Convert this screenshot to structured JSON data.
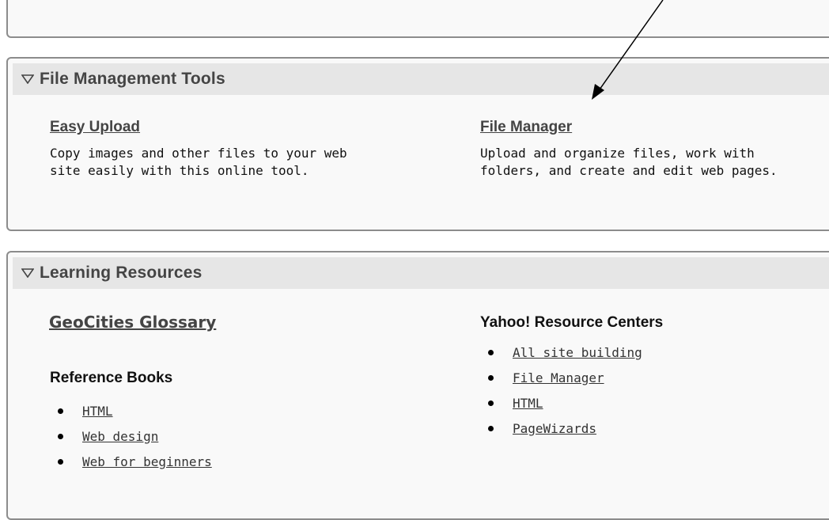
{
  "file_management": {
    "title": "File Management Tools",
    "easy_upload": {
      "label": "Easy Upload",
      "description": "Copy images and other files to your web\nsite easily with this online tool."
    },
    "file_manager": {
      "label": "File Manager",
      "description": "Upload and organize files, work with\nfolders, and create and edit web pages."
    }
  },
  "learning_resources": {
    "title": "Learning Resources",
    "glossary_label": "GeoCities Glossary",
    "reference_books": {
      "heading": "Reference Books",
      "items": [
        "HTML",
        "Web design",
        "Web for beginners"
      ]
    },
    "resource_centers": {
      "heading": "Yahoo! Resource Centers",
      "items": [
        "All site building",
        "File Manager",
        "HTML",
        "PageWizards"
      ]
    }
  },
  "icons": {
    "collapse": "triangle-down-outline-icon",
    "annotation": "arrow-pointer"
  }
}
